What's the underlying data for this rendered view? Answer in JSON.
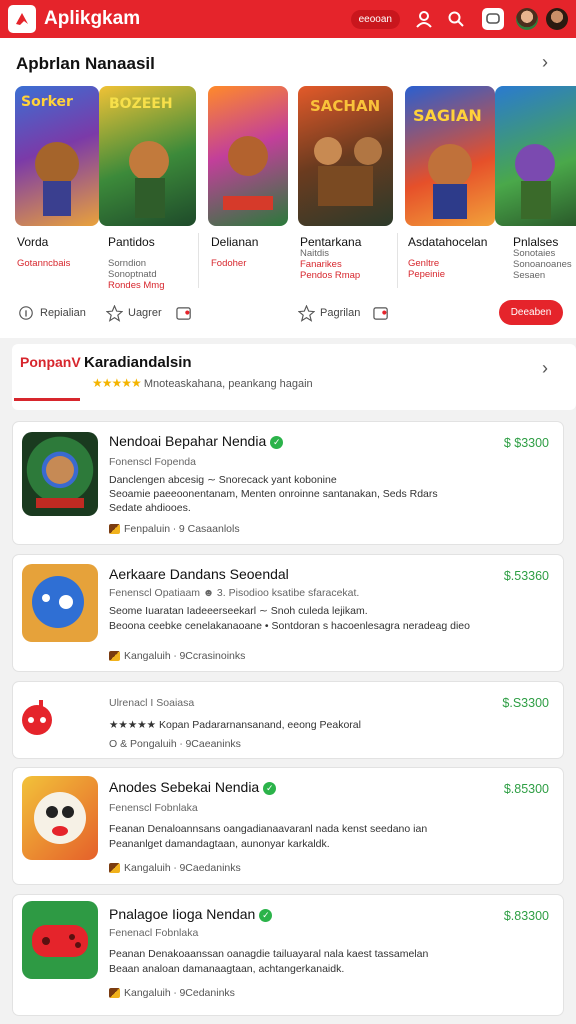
{
  "app": {
    "title": "Aplikgkam",
    "pill": "eeooan"
  },
  "section1": {
    "title": "Apbrlan Nanaasil",
    "games": [
      {
        "name": "Vorda",
        "sub1": "Gotanncbais",
        "sub2": "",
        "sub3": ""
      },
      {
        "name": "Pantidos",
        "sub1": "Sorndion",
        "sub2": "Sonoptnatd",
        "sub3": "Rondes Mmg"
      },
      {
        "name": "Delianan",
        "sub1": "Fodoher",
        "sub2": "",
        "sub3": ""
      },
      {
        "name": "Pentarkana",
        "sub1": "Naitdis",
        "sub2": "Fanarikes",
        "sub3": "Pendos Rmap"
      },
      {
        "name": "Asdatahocelan",
        "sub1": "Genltre",
        "sub2": "Pepeinie",
        "sub3": ""
      },
      {
        "name": "Pnlalses",
        "sub1": "Sonotaies",
        "sub2": "Sonoanoanes",
        "sub3": "Sesaen"
      }
    ],
    "actions": {
      "a1": "Repialian",
      "a2": "Uagrer",
      "a3": "Pagrilan",
      "btn": "Deeaben"
    }
  },
  "section2": {
    "tab1": "PonpanV",
    "tab2": "Karadiandalsin",
    "stars": "★★★★★",
    "sub": "Mnoteaskahana, peankang hagain"
  },
  "cards": [
    {
      "title": "Nendoai Bepahar Nendia",
      "price": "$ $3300",
      "l1": "Fonenscl Fopenda",
      "l2": "Danclengen abcesig ∼ Snorecack yant kobonine",
      "l3": "Seoamie paeeoonentanam, Menten onroinne santanakan, Seds Rdars",
      "l4": "Sedate ahdiooes.",
      "foot": "Fenpaluin  ∙ 9 Casaanlols"
    },
    {
      "title": "Aerkaare Dandans Seoendal",
      "price": "$.53360",
      "l1": "Fenenscl Opatiaam  ☻ 3. Pisodioo ksatibe sfaracekat.",
      "l2": "Seome  Iuaratan  Iadeeerseekarl ∼ Snoh culeda lejikam.",
      "l3": "Beoona ceebke cenelakanaoane • Sontdoran s hacoenlesagra neradeag dieo",
      "l4": "",
      "foot": "Kangaluih  ∙ 9Ccrasinoinks"
    },
    {
      "title": "",
      "price": "$.S3300",
      "l1": "Ulrenacl I Soaiasa",
      "l2": "★★★★★ Kopan Padararnansanand, eeong Peakoral",
      "l3": "",
      "l4": "",
      "foot": "O & Pongaluih  ∙ 9Caeaninks"
    },
    {
      "title": "Anodes Sebekai Nendia",
      "price": "$.85300",
      "l1": "Fenenscl Fobnlaka",
      "l2": "Feanan Denaloannsans oangadianaavaranl nada kenst seedano ian",
      "l3": "Peananlget damandagtaan, aunonyar karkaldk.",
      "l4": "",
      "foot": "Kangaluih  ∙ 9Caedaninks"
    },
    {
      "title": "Pnalagoe Iioga  Nendan",
      "price": "$.83300",
      "l1": "Fenenacl Fobnlaka",
      "l2": "Peanan Denakoaanssan oanagdie tailuayaral nala kaest tassamelan",
      "l3": "Beaan analoan damanaagtaan, achtangerkanaidk.",
      "l4": "",
      "foot": "Kangaluih  ∙ 9Cedaninks"
    }
  ]
}
